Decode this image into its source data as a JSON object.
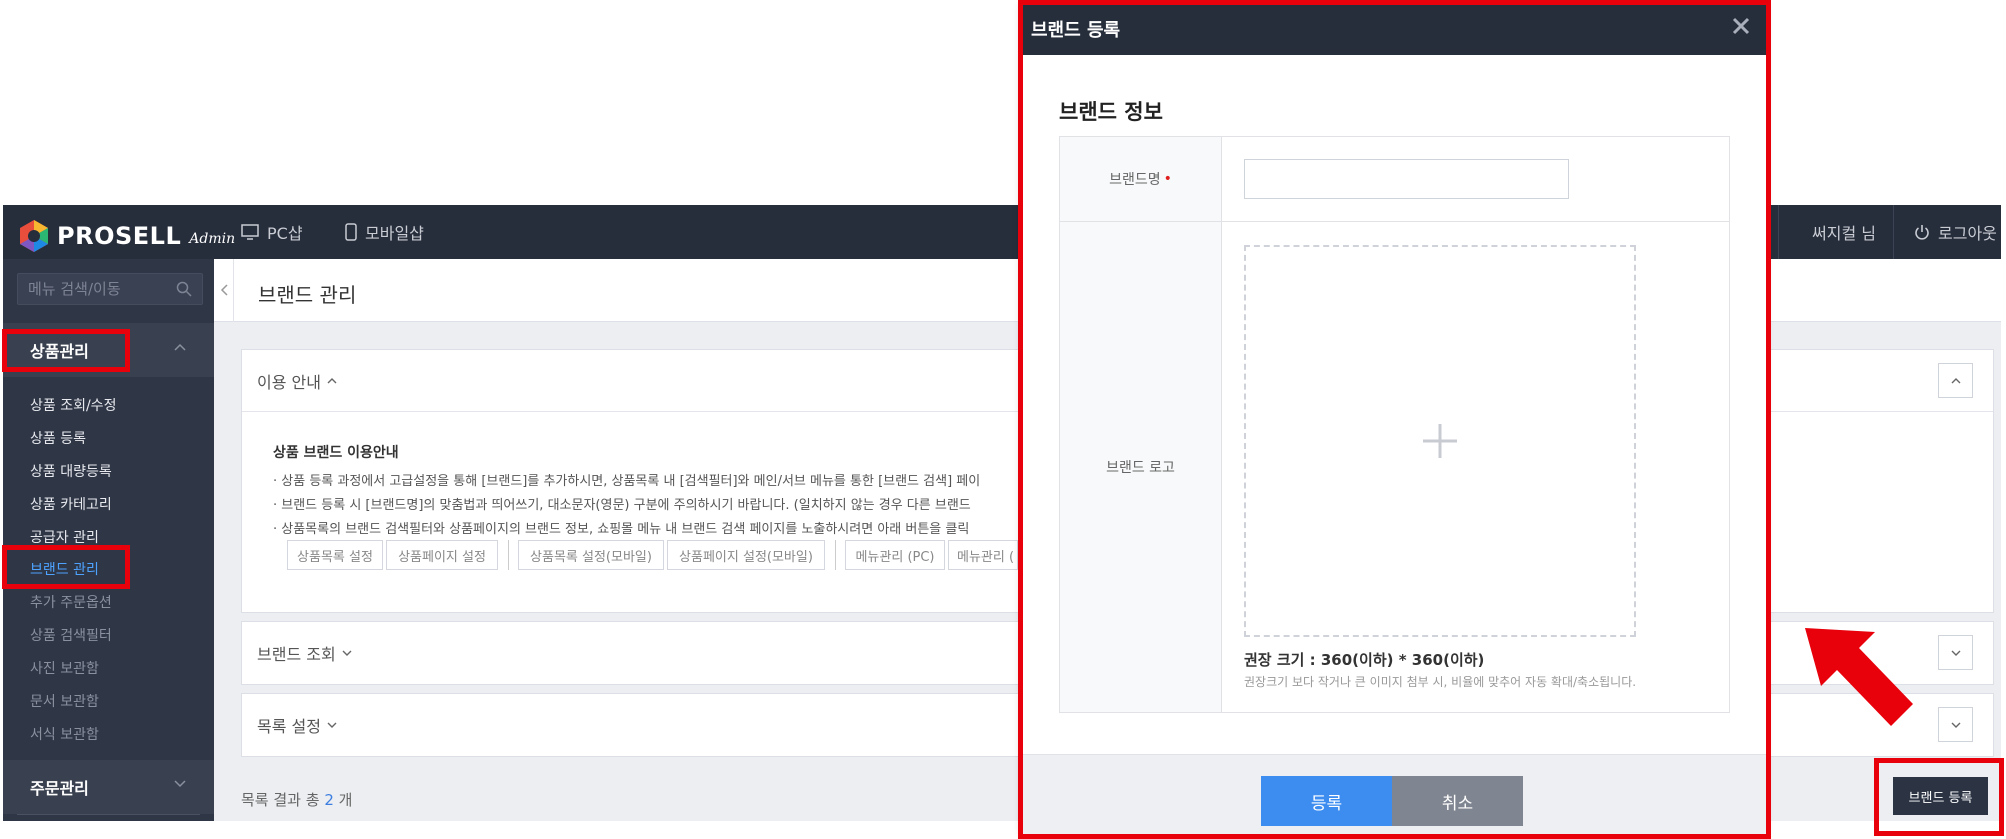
{
  "topbar": {
    "logo_text": "PROSELL",
    "logo_sub": "Admin",
    "nav": [
      {
        "label": "PC샵",
        "icon": "monitor-icon"
      },
      {
        "label": "모바일샵",
        "icon": "mobile-icon"
      }
    ],
    "user_label": "써지컬 님",
    "logout_label": "로그아웃"
  },
  "sidebar": {
    "search_placeholder": "메뉴 검색/이동",
    "group1": "상품관리",
    "items": [
      {
        "label": "상품 조회/수정",
        "state": "normal"
      },
      {
        "label": "상품 등록",
        "state": "normal"
      },
      {
        "label": "상품 대량등록",
        "state": "normal"
      },
      {
        "label": "상품 카테고리",
        "state": "normal"
      },
      {
        "label": "공급자 관리",
        "state": "normal"
      },
      {
        "label": "브랜드 관리",
        "state": "active"
      },
      {
        "label": "추가 주문옵션",
        "state": "dim"
      },
      {
        "label": "상품 검색필터",
        "state": "dim"
      },
      {
        "label": "사진 보관함",
        "state": "dim"
      },
      {
        "label": "문서 보관함",
        "state": "dim"
      },
      {
        "label": "서식 보관함",
        "state": "dim"
      }
    ],
    "group2": "주문관리"
  },
  "main": {
    "page_title": "브랜드 관리",
    "guide": {
      "header": "이용 안내",
      "title": "상품 브랜드 이용안내",
      "lines": [
        "· 상품 등록 과정에서 고급설정을 통해 [브랜드]를 추가하시면, 상품목록 내 [검색필터]와 메인/서브 메뉴를 통한 [브랜드 검색] 페이",
        "· 브랜드 등록 시 [브랜드명]의 맞춤법과 띄어쓰기, 대소문자(영문) 구분에 주의하시기 바랍니다. (일치하지 않는 경우 다른 브랜드",
        "· 상품목록의 브랜드 검색필터와 상품페이지의 브랜드 정보, 쇼핑몰 메뉴 내 브랜드 검색 페이지를 노출하시려면 아래 버튼을 클릭"
      ],
      "buttons": [
        "상품목록 설정",
        "상품페이지 설정",
        "상품목록 설정(모바일)",
        "상품페이지 설정(모바일)",
        "메뉴관리 (PC)",
        "메뉴관리 ("
      ]
    },
    "brand_search": "브랜드 조회",
    "list_settings": "목록 설정",
    "result_prefix": "목록 결과 총",
    "result_count": "2",
    "result_suffix": "개",
    "register_button": "브랜드 등록"
  },
  "modal": {
    "title": "브랜드 등록",
    "section_title": "브랜드 정보",
    "name_label": "브랜드명",
    "required_mark": "•",
    "name_value": "",
    "logo_label": "브랜드 로고",
    "recommended_size": "권장 크기 : 360(이하) * 360(이하)",
    "recommended_note": "권장크기 보다 작거나 큰 이미지 첨부 시, 비율에 맞추어 자동 확대/축소됩니다.",
    "ok_button": "등록",
    "cancel_button": "취소"
  },
  "colors": {
    "topbar": "#262d3b",
    "sidebar": "#2f3646",
    "accent": "#3d8df0",
    "highlight": "#e8000b"
  }
}
